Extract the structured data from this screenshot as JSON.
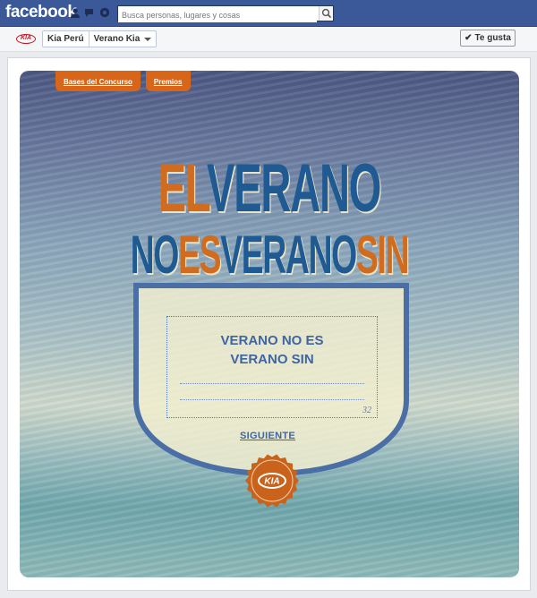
{
  "topbar": {
    "logo": "facebook",
    "search_placeholder": "Busca personas, lugares y cosas",
    "jewels": [
      "friends-icon",
      "messages-icon",
      "notifications-icon"
    ]
  },
  "pagebar": {
    "brand_logo": "KIA",
    "crumbs": [
      "Kia Perú",
      "Verano Kia"
    ],
    "like_label": "Te gusta"
  },
  "app": {
    "tabs": [
      "Bases del Concurso",
      "Premios"
    ],
    "headline_line1": {
      "part1": "EL",
      "part2": "VERANO"
    },
    "headline_line2": {
      "part1": "NO",
      "part2": "ES",
      "part3": "VERANO",
      "part4": "SIN"
    },
    "form": {
      "text_line1": "VERANO NO ES",
      "text_line2": "VERANO SIN",
      "counter": "32"
    },
    "next_label": "SIGUIENTE",
    "seal_logo": "KIA"
  },
  "colors": {
    "fb_blue": "#3b5998",
    "orange": "#d06c1f",
    "blue": "#1f5a93",
    "cream": "#f3efcf"
  }
}
